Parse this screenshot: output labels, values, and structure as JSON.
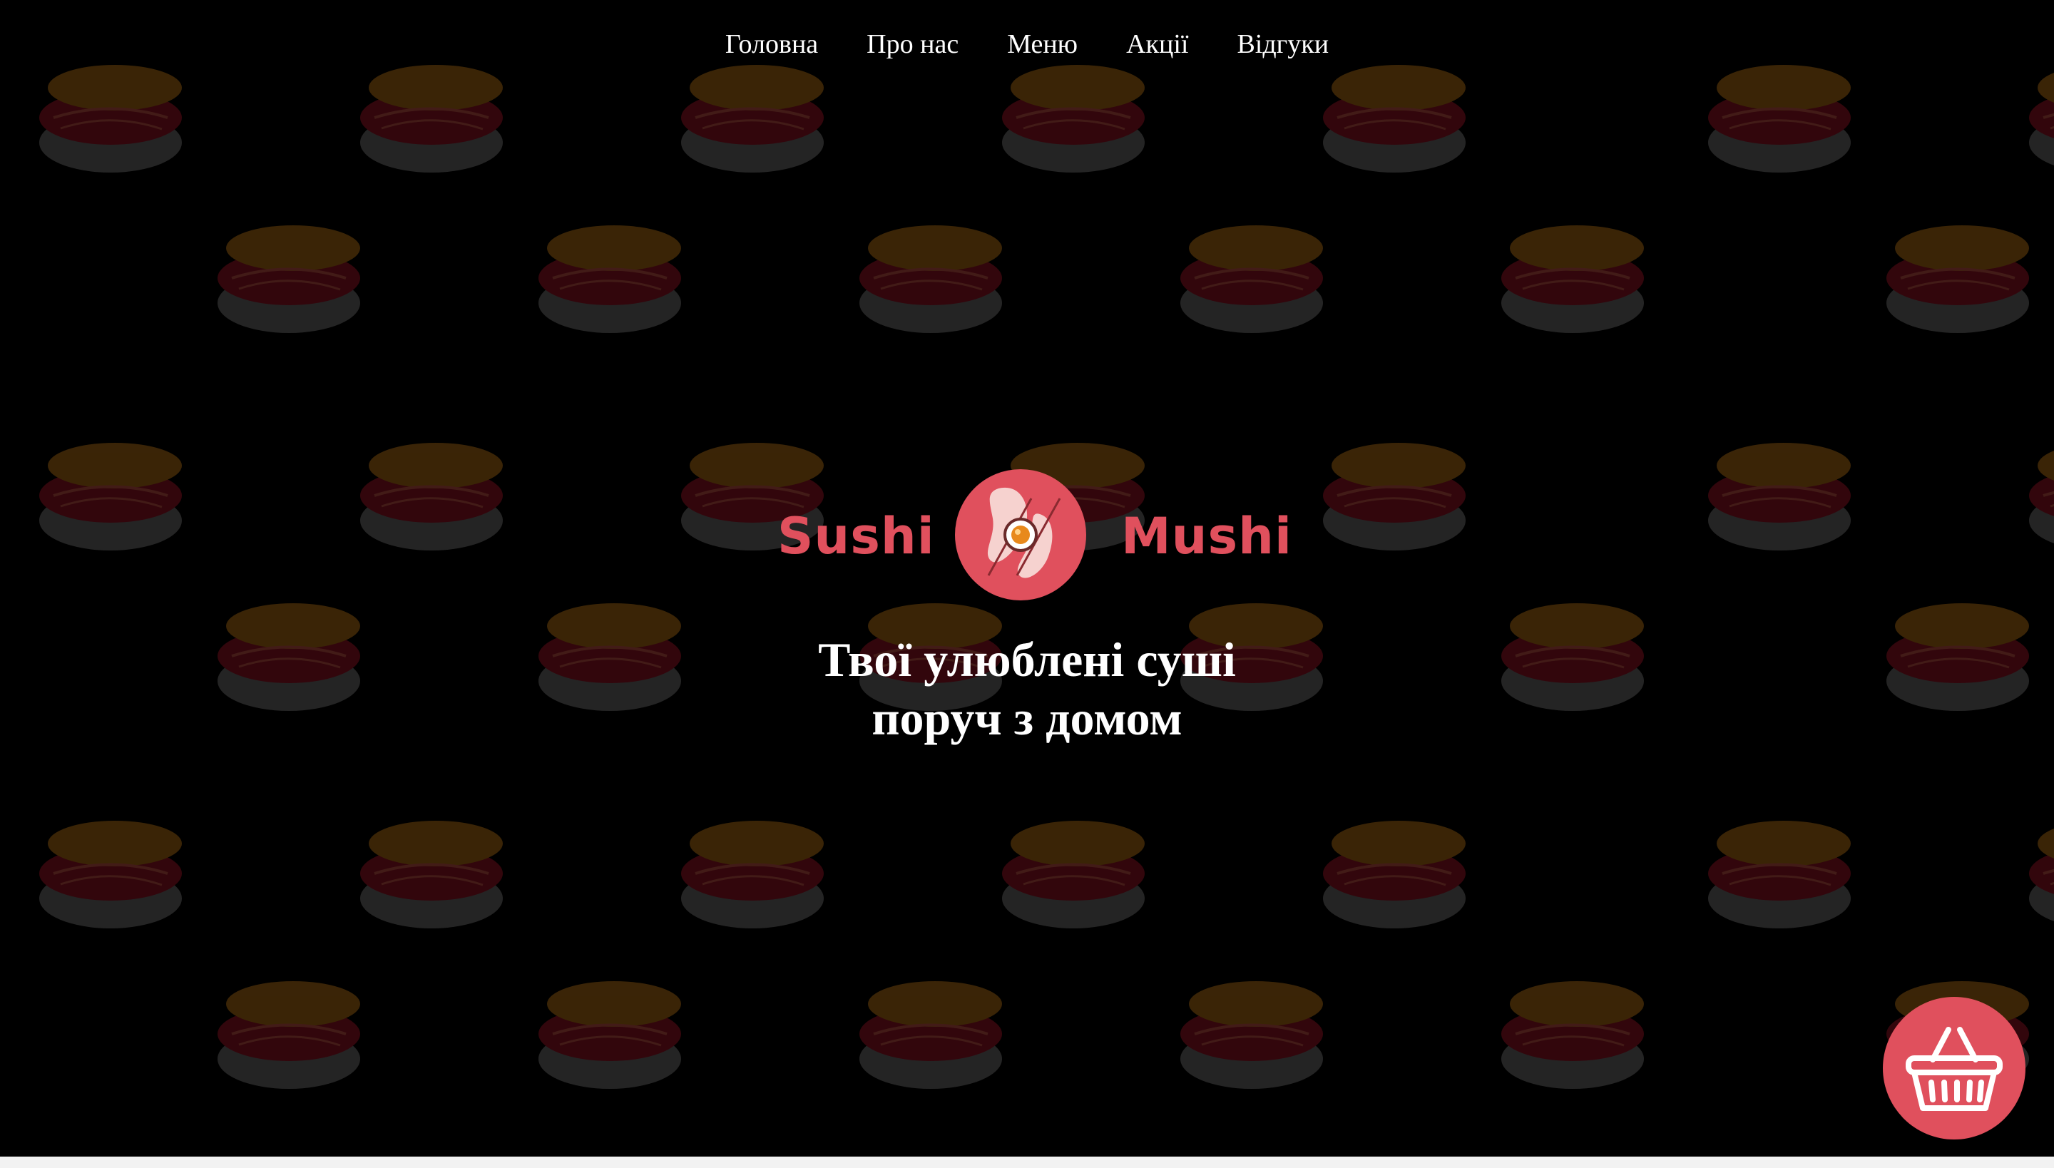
{
  "nav": {
    "items": [
      {
        "label": "Головна"
      },
      {
        "label": "Про нас"
      },
      {
        "label": "Меню"
      },
      {
        "label": "Акції"
      },
      {
        "label": "Відгуки"
      }
    ]
  },
  "logo": {
    "word_left": "Sushi",
    "word_right": "Mushi",
    "brand_color": "#e0505d",
    "emblem_icon": "sushi-roll-chopsticks-icon"
  },
  "hero": {
    "tagline_line1": "Твої улюблені суші",
    "tagline_line2": "поруч з домом"
  },
  "cart": {
    "icon": "basket-icon",
    "color": "#e0505d"
  },
  "background": {
    "color": "#000000",
    "pattern_icon": "nigiri-sushi-icon"
  }
}
